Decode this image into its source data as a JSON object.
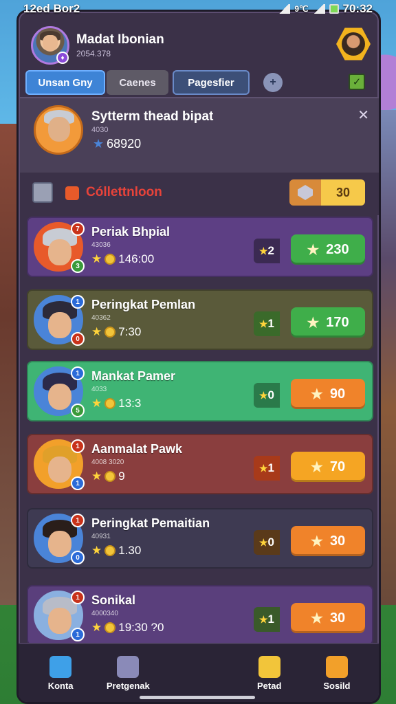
{
  "status": {
    "carrier": "12ed Bor2",
    "net": "9℃",
    "time": "70:32"
  },
  "header": {
    "player_name": "Madat Ibonian",
    "player_id": "2054.378"
  },
  "tabs": [
    {
      "label": "Unsan Gny"
    },
    {
      "label": "Caenes"
    },
    {
      "label": "Pagesfier"
    }
  ],
  "tab_add_symbol": "+",
  "check_symbol": "✓",
  "system": {
    "title": "Sytterm thead bipat",
    "sub": "4030",
    "score": "68920",
    "close": "✕"
  },
  "section": {
    "title": "Cóllettnloon",
    "count": "30"
  },
  "rows": [
    {
      "name": "Periak Bhpial",
      "sub": "43036",
      "stats": "146:00",
      "rank": "2",
      "points": "230",
      "bg": "#5d3f84",
      "btn": "#3fae4a",
      "pill": "#3b2a52",
      "ring": "#e85a2a",
      "hair": "#c8ccd4",
      "badge_top": "#c8321a",
      "badge_bot": "#3a9a3a",
      "btop": "7",
      "bbot": "3"
    },
    {
      "name": "Peringkat Pemlan",
      "sub": "40362",
      "stats": "7:30",
      "rank": "1",
      "points": "170",
      "bg": "#5a5a3a",
      "btn": "#3fae4a",
      "pill": "#3a6a2a",
      "ring": "#4a84d8",
      "hair": "#2c2a3a",
      "badge_top": "#2a6ad8",
      "badge_bot": "#c8321a",
      "btop": "1",
      "bbot": "0"
    },
    {
      "name": "Mankat Pamer",
      "sub": "4033",
      "stats": "13:3",
      "rank": "0",
      "points": "90",
      "bg": "#3fb474",
      "btn": "#f0832a",
      "pill": "#2a7a4a",
      "ring": "#4a84d8",
      "hair": "#2c2a4a",
      "badge_top": "#2a6ad8",
      "badge_bot": "#3a9a3a",
      "btop": "1",
      "bbot": "5"
    },
    {
      "name": "Aanmalat Pawk",
      "sub": "4008 3020",
      "stats": "9",
      "rank": "1",
      "points": "70",
      "bg": "#8a3e3e",
      "btn": "#f5a523",
      "pill": "#a83a1a",
      "ring": "#f2a02a",
      "hair": "#e0a02a",
      "badge_top": "#c8321a",
      "badge_bot": "#2a6ad8",
      "btop": "1",
      "bbot": "1"
    },
    {
      "name": "Peringkat Pemaitian",
      "sub": "40931",
      "stats": "1.30",
      "rank": "0",
      "points": "30",
      "bg": "#3e3a52",
      "btn": "#f0832a",
      "pill": "#5a3a1a",
      "ring": "#4a84d8",
      "hair": "#2a1e1a",
      "badge_top": "#c8321a",
      "badge_bot": "#2a6ad8",
      "btop": "1",
      "bbot": "0"
    },
    {
      "name": "Sonikal",
      "sub": "4000340",
      "stats": "19:30 ?0",
      "rank": "1",
      "points": "30",
      "bg": "#5a3f7c",
      "btn": "#f0832a",
      "pill": "#3a5a2a",
      "ring": "#8ab0e0",
      "hair": "#b8bcc8",
      "badge_top": "#c8321a",
      "badge_bot": "#2a6ad8",
      "btop": "1",
      "bbot": "1"
    }
  ],
  "nav": [
    {
      "label": "Konta",
      "color": "#3ea0e8"
    },
    {
      "label": "Pretgenak",
      "color": "#8a8ab8"
    },
    {
      "label": "Petad",
      "color": "#f2c53a"
    },
    {
      "label": "Sosild",
      "color": "#f2a02a"
    }
  ]
}
